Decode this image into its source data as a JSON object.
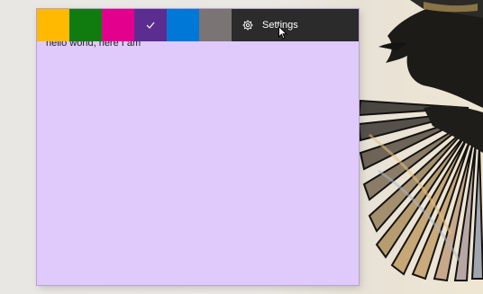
{
  "note": {
    "background_color": "#e0c9fb",
    "text": "hello world, here I am"
  },
  "color_swatches": [
    {
      "name": "yellow",
      "color": "#ffb900",
      "selected": false
    },
    {
      "name": "green",
      "color": "#107c10",
      "selected": false
    },
    {
      "name": "pink",
      "color": "#e3008c",
      "selected": false
    },
    {
      "name": "purple",
      "color": "#5c2d91",
      "selected": true
    },
    {
      "name": "blue",
      "color": "#0078d7",
      "selected": false
    },
    {
      "name": "gray",
      "color": "#7a7574",
      "selected": false
    }
  ],
  "settings": {
    "label": "Settings",
    "icon": "gear-icon"
  },
  "selected_check_icon": "checkmark-icon"
}
